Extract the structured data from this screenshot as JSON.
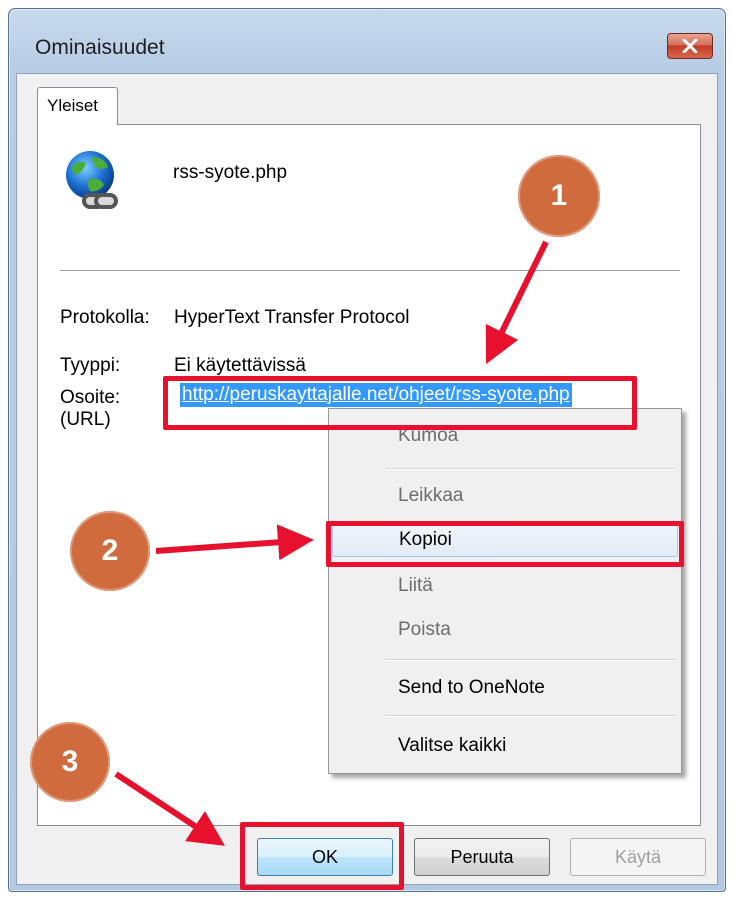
{
  "window": {
    "title": "Ominaisuudet",
    "close_icon": "close-icon"
  },
  "tabs": [
    {
      "label": "Yleiset",
      "active": true
    }
  ],
  "file": {
    "icon": "internet-shortcut-icon",
    "name": "rss-syote.php"
  },
  "properties": {
    "protocol_label": "Protokolla:",
    "protocol_value": "HyperText Transfer Protocol",
    "type_label": "Tyyppi:",
    "type_value": "Ei käytettävissä",
    "address_label_line1": "Osoite:",
    "address_label_line2": "(URL)",
    "address_value": "http://peruskayttajalle.net/ohjeet/rss-syote.php"
  },
  "context_menu": {
    "items": [
      {
        "label": "Kumoa",
        "enabled": false
      },
      {
        "label": "Leikkaa",
        "enabled": false
      },
      {
        "label": "Kopioi",
        "enabled": true,
        "highlighted": true
      },
      {
        "label": "Liitä",
        "enabled": false
      },
      {
        "label": "Poista",
        "enabled": false
      },
      {
        "label": "Send to OneNote",
        "enabled": true
      },
      {
        "label": "Valitse kaikki",
        "enabled": true
      }
    ]
  },
  "buttons": {
    "ok": "OK",
    "cancel": "Peruuta",
    "apply": "Käytä"
  },
  "annotations": {
    "badge_1": "1",
    "badge_2": "2",
    "badge_3": "3",
    "highlight_color": "#e8112d",
    "badge_color": "#d06b3d"
  },
  "colors": {
    "selection": "#3399ff",
    "titlebar": "#c7d9ec"
  }
}
